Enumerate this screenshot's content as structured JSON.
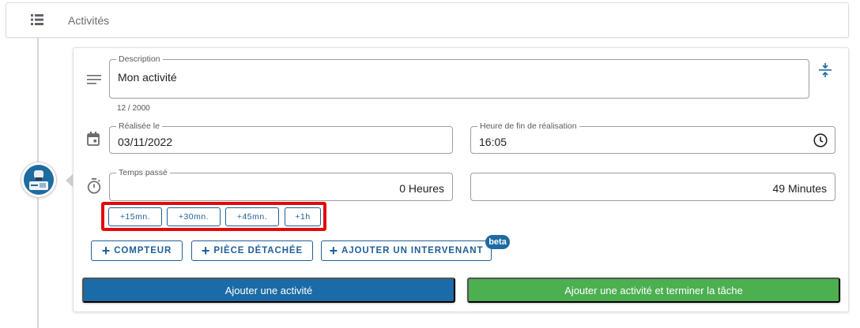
{
  "header": {
    "title": "Activités",
    "icon": "list-icon"
  },
  "description": {
    "label": "Description",
    "value": "Mon activité",
    "counter": "12 / 2000",
    "icon": "notes-icon",
    "collapse_icon": "collapse-icon"
  },
  "date": {
    "label": "Réalisée le",
    "value": "03/11/2022",
    "icon": "calendar-icon"
  },
  "end_time": {
    "label": "Heure de fin de réalisation",
    "value": "16:05",
    "icon": "clock-icon"
  },
  "time_spent": {
    "label": "Temps passé",
    "hours": "0 Heures",
    "minutes": "49 Minutes",
    "icon": "timer-icon"
  },
  "quick_add": [
    "+15mn.",
    "+30mn.",
    "+45mn.",
    "+1h"
  ],
  "extra_buttons": {
    "counter": "COMPTEUR",
    "spare_part": "PIÈCE DÉTACHÉE",
    "add_worker": "AJOUTER UN INTERVENANT",
    "beta": "beta"
  },
  "actions": {
    "add": "Ajouter une activité",
    "add_and_finish": "Ajouter une activité et terminer la tâche"
  },
  "colors": {
    "primary": "#1a6ba7",
    "success": "#4caf50",
    "highlight": "#e20a0a"
  }
}
